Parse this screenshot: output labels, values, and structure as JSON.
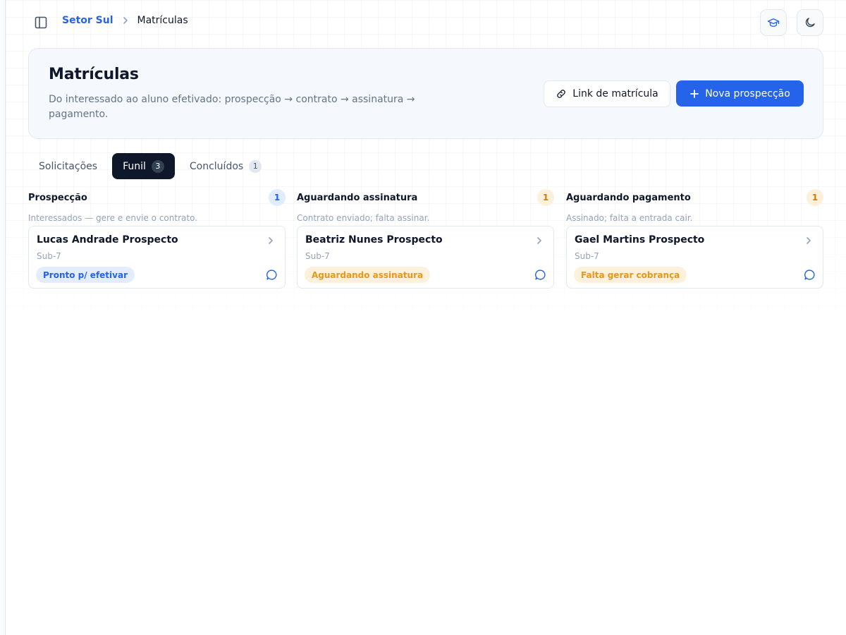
{
  "breadcrumb": {
    "parent": "Setor Sul",
    "current": "Matrículas"
  },
  "header": {
    "title": "Matrículas",
    "subtitle": "Do interessado ao aluno efetivado: prospecção → contrato → assinatura → pagamento.",
    "link_button": "Link de matrícula",
    "new_button": "Nova prospecção"
  },
  "tabs": [
    {
      "label": "Solicitações",
      "count": ""
    },
    {
      "label": "Funil",
      "count": "3"
    },
    {
      "label": "Concluídos",
      "count": "1"
    }
  ],
  "columns": [
    {
      "title": "Prospecção",
      "count": "1",
      "description": "Interessados — gere e envie o contrato.",
      "card": {
        "name": "Lucas Andrade Prospecto",
        "sub": "Sub-7",
        "tag": "Pronto p/ efetivar"
      }
    },
    {
      "title": "Aguardando assinatura",
      "count": "1",
      "description": "Contrato enviado; falta assinar.",
      "card": {
        "name": "Beatriz Nunes Prospecto",
        "sub": "Sub-7",
        "tag": "Aguardando assinatura"
      }
    },
    {
      "title": "Aguardando pagamento",
      "count": "1",
      "description": "Assinado; falta a entrada cair.",
      "card": {
        "name": "Gael Martins Prospecto",
        "sub": "Sub-7",
        "tag": "Falta gerar cobrança"
      }
    }
  ],
  "colors": {
    "primary": "#2563eb",
    "dark": "#0f172a",
    "amber": "#d97706",
    "muted": "#94a3b8"
  },
  "icons": [
    "sidebar-toggle-icon",
    "chevron-right-icon",
    "graduation-cap-icon",
    "moon-icon",
    "link-icon",
    "plus-icon",
    "chat-bubble-icon"
  ]
}
